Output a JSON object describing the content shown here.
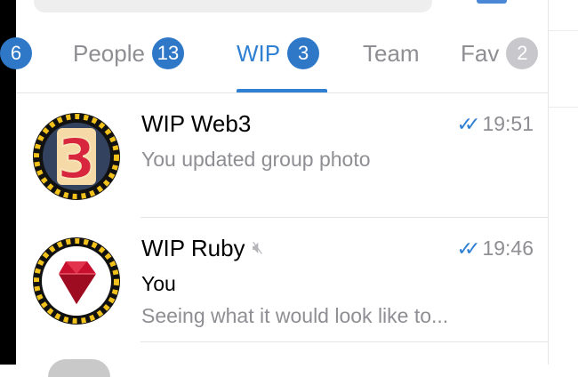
{
  "search": {
    "placeholder": ""
  },
  "tabs": [
    {
      "label": "",
      "count": "6"
    },
    {
      "label": "People",
      "count": "13"
    },
    {
      "label": "WIP",
      "count": "3",
      "active": true
    },
    {
      "label": "Team",
      "count": ""
    },
    {
      "label": "Fav",
      "count": "2"
    }
  ],
  "chats": [
    {
      "title": "WIP Web3",
      "time": "19:51",
      "status": "read",
      "message": "You updated group photo",
      "avatar": "number-3-badge"
    },
    {
      "title": "WIP Ruby",
      "muted": true,
      "time": "19:46",
      "status": "read",
      "sender": "You",
      "message": "Seeing what it would look like to...",
      "avatar": "ruby-gem"
    }
  ],
  "colors": {
    "accent": "#2f7fd3",
    "badge_grey": "#c7c7cc",
    "muted_text": "#8e8e93"
  }
}
